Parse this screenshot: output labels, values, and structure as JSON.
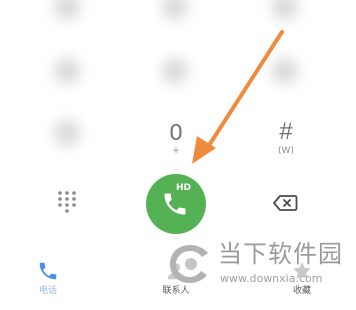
{
  "dialpad": {
    "zero_digit": "0",
    "zero_sub": "+",
    "hash_digit": "#",
    "hash_sub": "(W)"
  },
  "call_button": {
    "badge": "HD",
    "color": "#54b154"
  },
  "bottom_nav": {
    "items": [
      {
        "label": "电话",
        "icon": "phone-icon",
        "active": true
      },
      {
        "label": "联系人",
        "icon": "contacts-icon",
        "active": false
      },
      {
        "label": "收藏",
        "icon": "star-icon",
        "active": false
      }
    ]
  },
  "annotation": {
    "arrow_color": "#f08a3c"
  },
  "watermark": {
    "title": "当下软件园",
    "url": "www.downxia.com"
  }
}
